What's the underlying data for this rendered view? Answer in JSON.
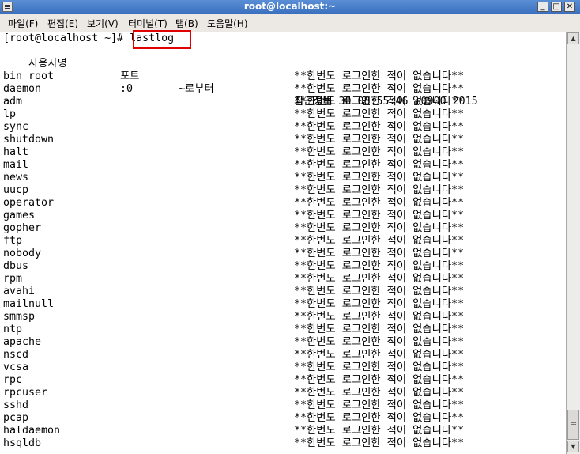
{
  "window": {
    "title": "root@localhost:~"
  },
  "window_buttons": {
    "minimize": "_",
    "maximize": "□",
    "close": "✕"
  },
  "menu": [
    {
      "label": "파일(F)"
    },
    {
      "label": "편집(E)"
    },
    {
      "label": "보기(V)"
    },
    {
      "label": "터미널(T)"
    },
    {
      "label": "탭(B)"
    },
    {
      "label": "도움말(H)"
    }
  ],
  "terminal": {
    "prompt": "[root@localhost ~]# ",
    "command": "lastlog",
    "header": {
      "user": "사용자명",
      "port": "포트",
      "from": "~로부터",
      "latest": "최근정보"
    },
    "root_row": {
      "user": "root",
      "port": ":0",
      "latest": "금 10월 30 08:55:46 +0900 2015"
    },
    "never_msg": "**한번도 로그인한 적이 없습니다**",
    "never_users": [
      "bin",
      "daemon",
      "adm",
      "lp",
      "sync",
      "shutdown",
      "halt",
      "mail",
      "news",
      "uucp",
      "operator",
      "games",
      "gopher",
      "ftp",
      "nobody",
      "dbus",
      "rpm",
      "avahi",
      "mailnull",
      "smmsp",
      "ntp",
      "apache",
      "nscd",
      "vcsa",
      "rpc",
      "rpcuser",
      "sshd",
      "pcap",
      "haldaemon",
      "hsqldb"
    ]
  },
  "colors": {
    "highlight": "#e00000",
    "titlebar": "#3a6fbe"
  },
  "icons": {
    "app": "terminal-icon",
    "scroll_up": "arrow-up-icon",
    "scroll_down": "arrow-down-icon"
  }
}
